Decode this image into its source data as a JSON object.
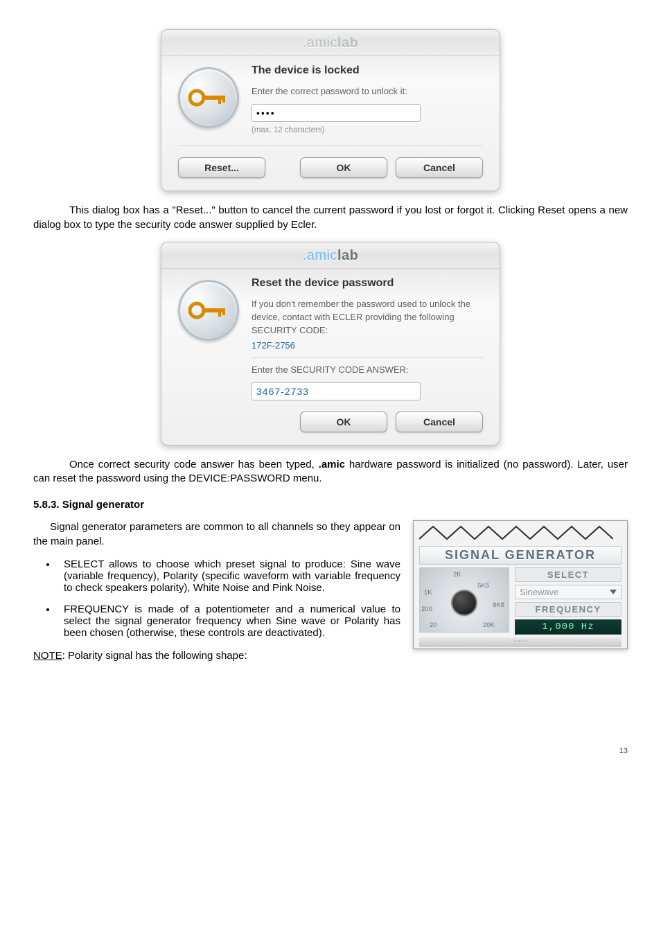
{
  "dialog1": {
    "titlebar_prefix": ".amic",
    "titlebar_suffix": "lab",
    "heading": "The device is locked",
    "prompt": "Enter the correct password to unlock it:",
    "password_value": "••••",
    "hint": "(max. 12 characters)",
    "reset_btn": "Reset...",
    "ok_btn": "OK",
    "cancel_btn": "Cancel"
  },
  "para1": "This dialog box has a \"Reset...\" button to cancel the current password if you lost or forgot it. Clicking Reset opens a new dialog box to type the security code answer supplied by Ecler.",
  "dialog2": {
    "titlebar_prefix": ".amic",
    "titlebar_suffix": "lab",
    "heading": "Reset the device password",
    "prompt1": "If you don't remember the password used to unlock the device, contact with ECLER providing the following SECURITY CODE:",
    "code1": "172F-2756",
    "prompt2": "Enter the SECURITY CODE ANSWER:",
    "code2": "3467-2733",
    "ok_btn": "OK",
    "cancel_btn": "Cancel"
  },
  "para2_a": "Once correct security code answer has been typed, ",
  "para2_b": ".amic",
  "para2_c": " hardware password is initialized (no password). Later, user can reset the password using the DEVICE:PASSWORD menu.",
  "section_heading": "5.8.3. Signal generator",
  "para3": "Signal generator parameters are common to all channels so they appear on the main panel.",
  "bullet1": "SELECT allows to choose which preset signal to produce: Sine wave (variable frequency), Polarity (specific waveform with variable frequency to check speakers polarity), White Noise and Pink Noise.",
  "bullet2": "FREQUENCY is made of a potentiometer and a numerical value to select the signal generator frequency when Sine wave or Polarity has been chosen (otherwise, these controls are deactivated).",
  "note_label": "NOTE",
  "note_rest": ": Polarity signal has the following shape:",
  "siggen": {
    "title": "SIGNAL GENERATOR",
    "select_label": "SELECT",
    "select_value": "Sinewave",
    "freq_label": "FREQUENCY",
    "freq_value": "1,000 Hz",
    "dial": {
      "t_1k": "1K",
      "t_2k": "2K",
      "t_5k5": "5K5",
      "t_200": "200",
      "t_8k8": "8K8",
      "t_20": "20",
      "t_20k": "20K"
    }
  },
  "page_number": "13"
}
